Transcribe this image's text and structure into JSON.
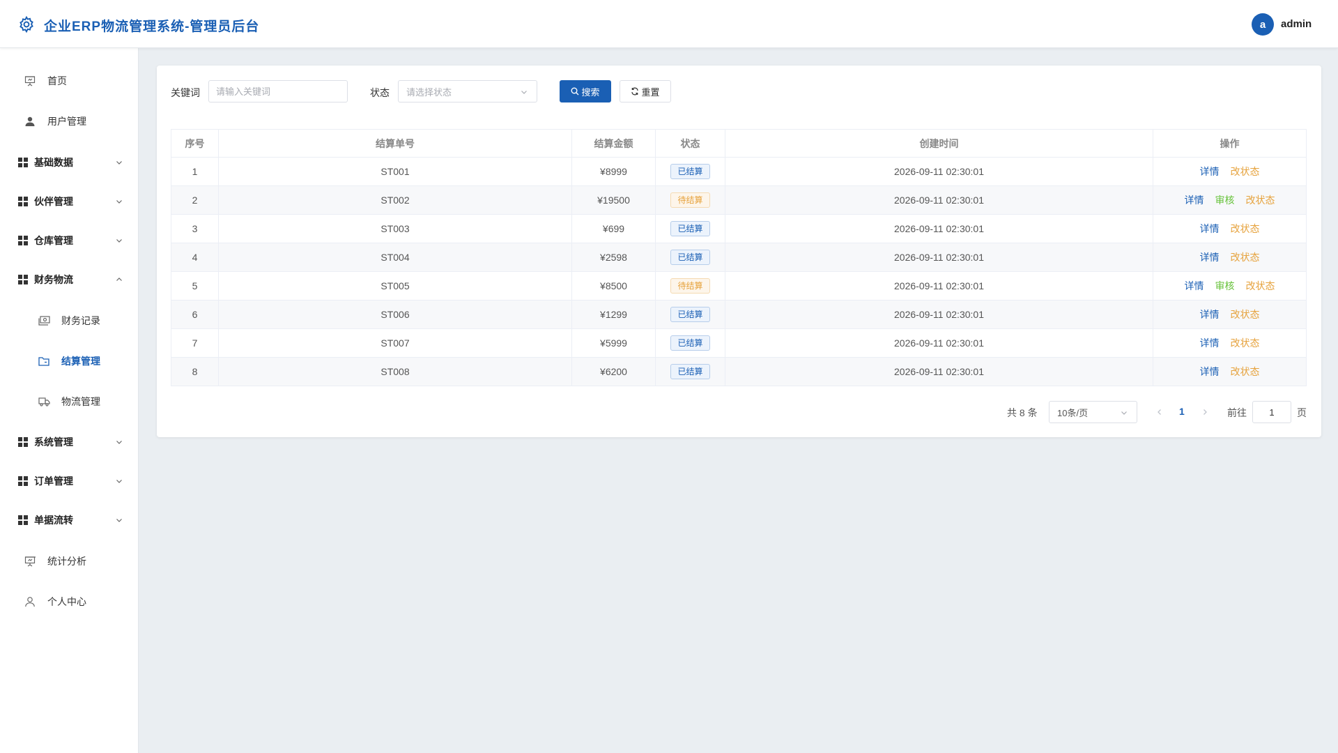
{
  "header": {
    "app_title": "企业ERP物流管理系统-管理员后台",
    "avatar_letter": "a",
    "user_name": "admin",
    "logo_icon": "gear-icon"
  },
  "sidebar": {
    "items": [
      {
        "label": "首页",
        "icon": "presentation-icon"
      },
      {
        "label": "用户管理",
        "icon": "user-icon"
      },
      {
        "label": "基础数据",
        "icon": "grid-icon",
        "expandable": true
      },
      {
        "label": "伙伴管理",
        "icon": "grid-icon",
        "expandable": true
      },
      {
        "label": "仓库管理",
        "icon": "grid-icon",
        "expandable": true
      },
      {
        "label": "财务物流",
        "icon": "grid-icon",
        "expandable": true,
        "expanded": true
      },
      {
        "label": "财务记录",
        "icon": "money-icon",
        "child": true
      },
      {
        "label": "结算管理",
        "icon": "folder-icon",
        "child": true,
        "active": true
      },
      {
        "label": "物流管理",
        "icon": "truck-icon",
        "child": true
      },
      {
        "label": "系统管理",
        "icon": "grid-icon",
        "expandable": true
      },
      {
        "label": "订单管理",
        "icon": "grid-icon",
        "expandable": true
      },
      {
        "label": "单据流转",
        "icon": "grid-icon",
        "expandable": true
      },
      {
        "label": "统计分析",
        "icon": "presentation-icon"
      },
      {
        "label": "个人中心",
        "icon": "user-outline-icon"
      }
    ]
  },
  "filters": {
    "keyword_label": "关键词",
    "keyword_placeholder": "请输入关键词",
    "status_label": "状态",
    "status_placeholder": "请选择状态",
    "search_label": "搜索",
    "reset_label": "重置"
  },
  "table": {
    "columns": [
      "序号",
      "结算单号",
      "结算金额",
      "状态",
      "创建时间",
      "操作"
    ],
    "rows": [
      {
        "index": "1",
        "code": "ST001",
        "amount": "¥8999",
        "status": "已结算",
        "status_type": "done",
        "created": "2026-09-11 02:30:01",
        "actions": [
          "详情",
          "改状态"
        ]
      },
      {
        "index": "2",
        "code": "ST002",
        "amount": "¥19500",
        "status": "待结算",
        "status_type": "pending",
        "created": "2026-09-11 02:30:01",
        "actions": [
          "详情",
          "审核",
          "改状态"
        ]
      },
      {
        "index": "3",
        "code": "ST003",
        "amount": "¥699",
        "status": "已结算",
        "status_type": "done",
        "created": "2026-09-11 02:30:01",
        "actions": [
          "详情",
          "改状态"
        ]
      },
      {
        "index": "4",
        "code": "ST004",
        "amount": "¥2598",
        "status": "已结算",
        "status_type": "done",
        "created": "2026-09-11 02:30:01",
        "actions": [
          "详情",
          "改状态"
        ]
      },
      {
        "index": "5",
        "code": "ST005",
        "amount": "¥8500",
        "status": "待结算",
        "status_type": "pending",
        "created": "2026-09-11 02:30:01",
        "actions": [
          "详情",
          "审核",
          "改状态"
        ]
      },
      {
        "index": "6",
        "code": "ST006",
        "amount": "¥1299",
        "status": "已结算",
        "status_type": "done",
        "created": "2026-09-11 02:30:01",
        "actions": [
          "详情",
          "改状态"
        ]
      },
      {
        "index": "7",
        "code": "ST007",
        "amount": "¥5999",
        "status": "已结算",
        "status_type": "done",
        "created": "2026-09-11 02:30:01",
        "actions": [
          "详情",
          "改状态"
        ]
      },
      {
        "index": "8",
        "code": "ST008",
        "amount": "¥6200",
        "status": "已结算",
        "status_type": "done",
        "created": "2026-09-11 02:30:01",
        "actions": [
          "详情",
          "改状态"
        ]
      }
    ]
  },
  "pagination": {
    "total_text": "共 8 条",
    "page_size": "10条/页",
    "current_page": "1",
    "goto_label": "前往",
    "goto_value": "1",
    "page_suffix": "页"
  },
  "colors": {
    "primary": "#1a5fb4",
    "success": "#67c23a",
    "warning": "#e6a23c"
  }
}
